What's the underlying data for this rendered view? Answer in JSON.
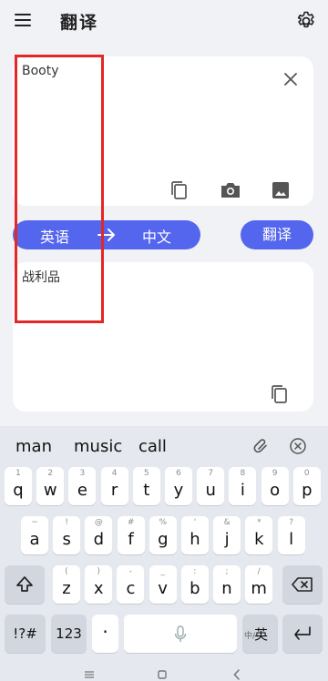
{
  "app": {
    "title": "翻译"
  },
  "input": {
    "text": "Booty"
  },
  "output": {
    "text": "战利品"
  },
  "languages": {
    "source": "英语",
    "target": "中文"
  },
  "actions": {
    "translate_label": "翻译"
  },
  "keyboard": {
    "suggestions": [
      "man",
      "music",
      "call"
    ],
    "row1": [
      {
        "sub": "1",
        "main": "q"
      },
      {
        "sub": "2",
        "main": "w"
      },
      {
        "sub": "3",
        "main": "e"
      },
      {
        "sub": "4",
        "main": "r"
      },
      {
        "sub": "5",
        "main": "t"
      },
      {
        "sub": "6",
        "main": "y"
      },
      {
        "sub": "7",
        "main": "u"
      },
      {
        "sub": "8",
        "main": "i"
      },
      {
        "sub": "9",
        "main": "o"
      },
      {
        "sub": "0",
        "main": "p"
      }
    ],
    "row2": [
      {
        "sub": "~",
        "main": "a"
      },
      {
        "sub": "!",
        "main": "s"
      },
      {
        "sub": "@",
        "main": "d"
      },
      {
        "sub": "#",
        "main": "f"
      },
      {
        "sub": "%",
        "main": "g"
      },
      {
        "sub": "'",
        "main": "h"
      },
      {
        "sub": "&",
        "main": "j"
      },
      {
        "sub": "*",
        "main": "k"
      },
      {
        "sub": "?",
        "main": "l"
      }
    ],
    "row3": [
      {
        "sub": "(",
        "main": "z"
      },
      {
        "sub": ")",
        "main": "x"
      },
      {
        "sub": "-",
        "main": "c"
      },
      {
        "sub": "_",
        "main": "v"
      },
      {
        "sub": ":",
        "main": "b"
      },
      {
        "sub": ";",
        "main": "n"
      },
      {
        "sub": "/",
        "main": "m"
      }
    ],
    "symbols_label": "!?#",
    "numbers_label": "123",
    "punct_label": "·",
    "lang_toggle_small": "中/",
    "lang_toggle_main": "英"
  }
}
